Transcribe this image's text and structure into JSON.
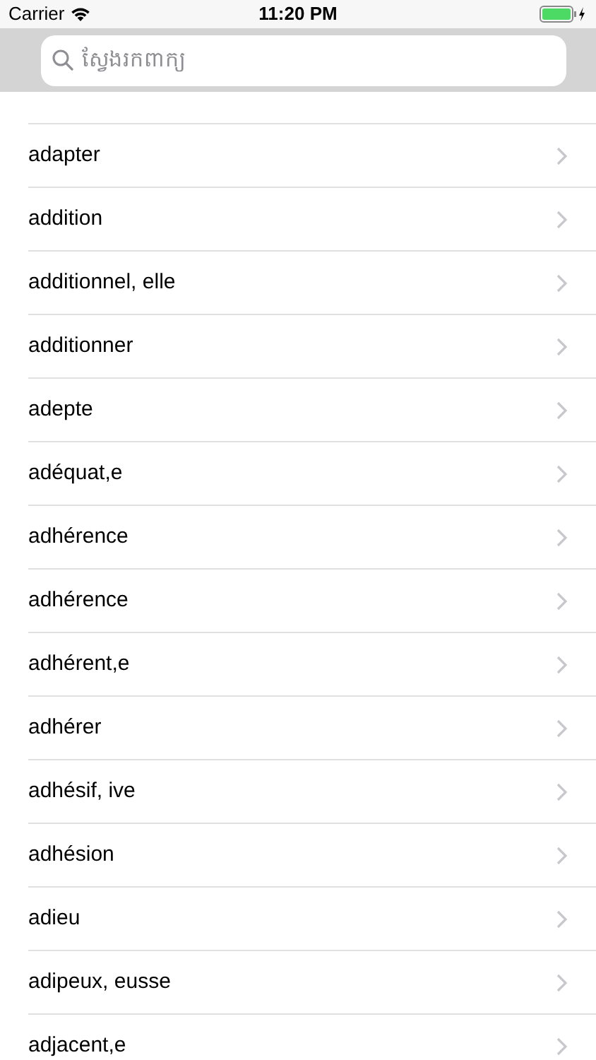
{
  "status_bar": {
    "carrier": "Carrier",
    "time": "11:20 PM"
  },
  "search": {
    "placeholder": "ស្វែងរកពាក្យ"
  },
  "words": [
    "adapter",
    "addition",
    "additionnel, elle",
    "additionner",
    "adepte",
    "adéquat,e",
    "adhérence",
    "adhérence",
    "adhérent,e",
    "adhérer",
    "adhésif, ive",
    "adhésion",
    "adieu",
    "adipeux, eusse",
    "adjacent,e"
  ]
}
